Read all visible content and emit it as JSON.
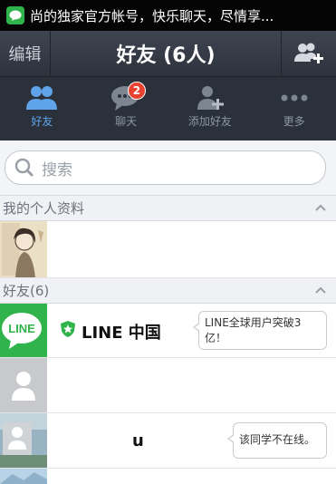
{
  "status_bar": {
    "notification_text": "尚的独家官方帐号，快乐聊天，尽情享..."
  },
  "title_bar": {
    "edit_label": "编辑",
    "title": "好友 (6人)"
  },
  "tabs": [
    {
      "label": "好友",
      "icon": "friends-icon",
      "active": true
    },
    {
      "label": "聊天",
      "icon": "chat-icon",
      "badge": "2"
    },
    {
      "label": "添加好友",
      "icon": "add-friend-icon"
    },
    {
      "label": "更多",
      "icon": "more-icon"
    }
  ],
  "search": {
    "placeholder": "搜索"
  },
  "sections": {
    "profile": {
      "title": "我的个人资料"
    },
    "friends": {
      "title": "好友(6)"
    }
  },
  "profile_row": {
    "name": ""
  },
  "friends": [
    {
      "name": "LINE 中国",
      "status_message": "LINE全球用户突破3亿！",
      "official": true
    },
    {
      "name": "",
      "status_message": ""
    },
    {
      "name": "u",
      "status_message": "该同学不在线。"
    }
  ],
  "colors": {
    "line_green": "#2fb34a",
    "accent_blue": "#5fa3ea",
    "badge_red": "#e8412f",
    "tab_bar": "#2b313a"
  }
}
